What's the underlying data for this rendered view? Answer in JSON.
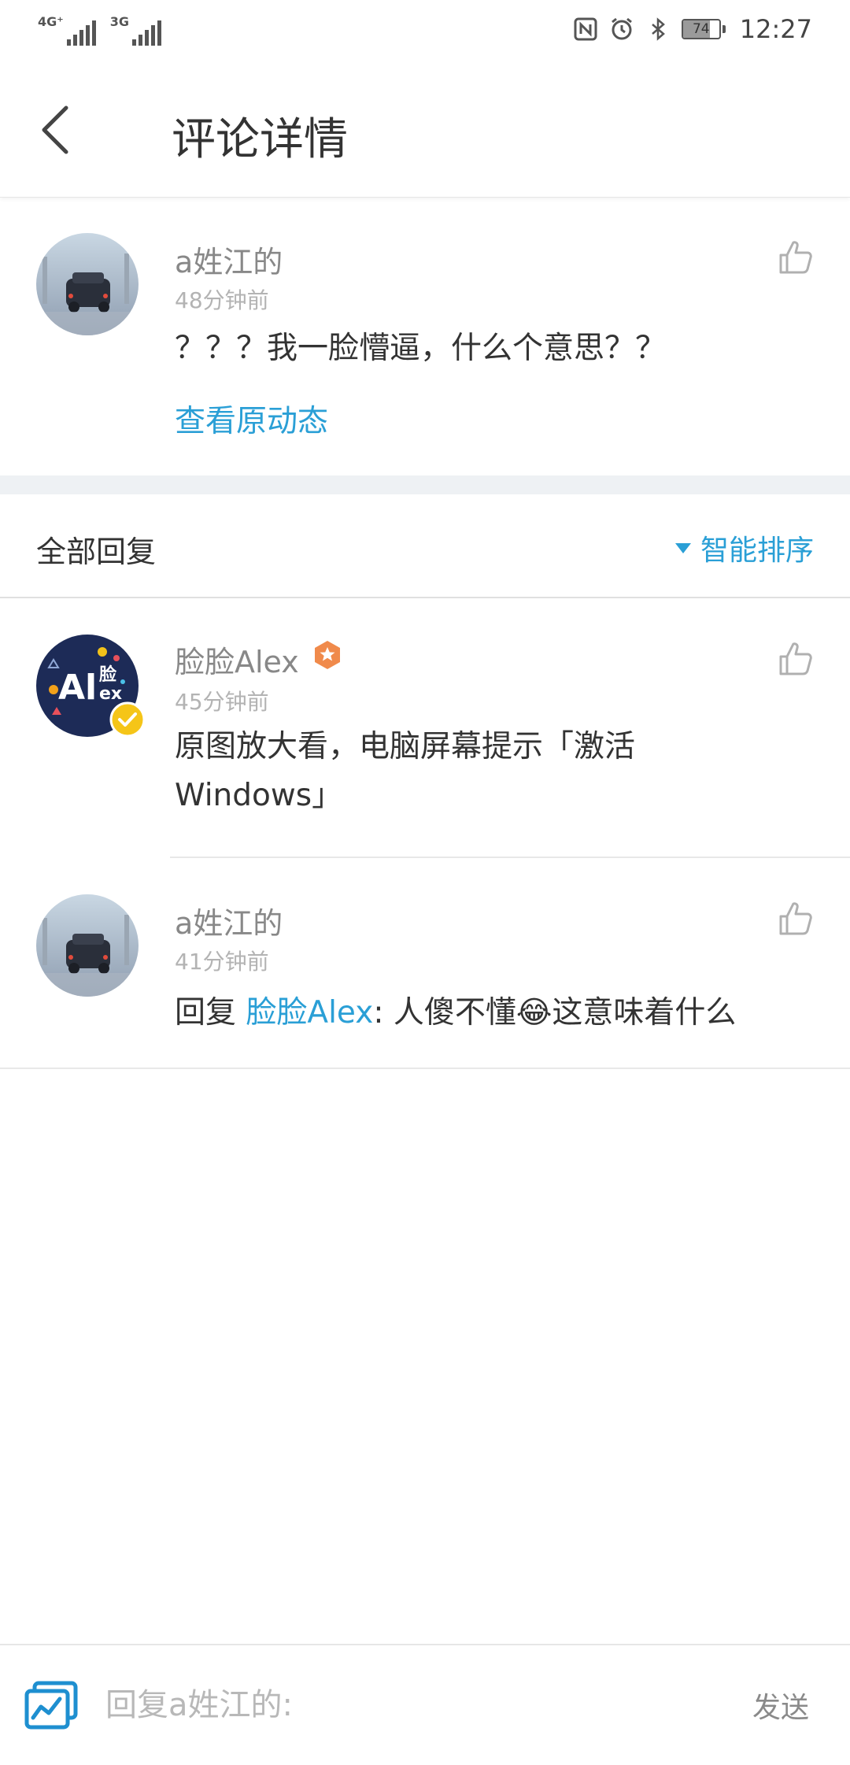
{
  "status_bar": {
    "network_1": "4G⁺",
    "network_2": "3G",
    "battery": "74",
    "battery_level": 0.74,
    "time": "12:27",
    "icons": [
      "nfc-icon",
      "alarm-icon",
      "bluetooth-icon"
    ]
  },
  "header": {
    "back_icon": "back-arrow-icon",
    "title": "评论详情"
  },
  "main_comment": {
    "username": "a姓江的",
    "time": "48分钟前",
    "text": "？？？我一脸懵逼，什么个意思？？",
    "view_original": "查看原动态",
    "like_icon": "thumbs-up-icon"
  },
  "replies_section": {
    "title": "全部回复",
    "sort_label": "智能排序"
  },
  "replies": [
    {
      "username": "脸脸Alex",
      "time": "45分钟前",
      "text": "原图放大看，电脑屏幕提示「激活Windows」",
      "avatar_text_a": "Al",
      "avatar_text_b": "脸",
      "avatar_text_c": "ex",
      "verified": true
    },
    {
      "username": "a姓江的",
      "time": "41分钟前",
      "reply_prefix": "回复 ",
      "reply_to": "脸脸Alex",
      "text": ": 人傻不懂😂这意味着什么"
    }
  ],
  "bottom_bar": {
    "placeholder": "回复a姓江的:",
    "send_label": "发送",
    "image_icon": "image-chart-icon"
  },
  "colors": {
    "accent": "#2a9fd6",
    "separator": "#eef1f4"
  }
}
